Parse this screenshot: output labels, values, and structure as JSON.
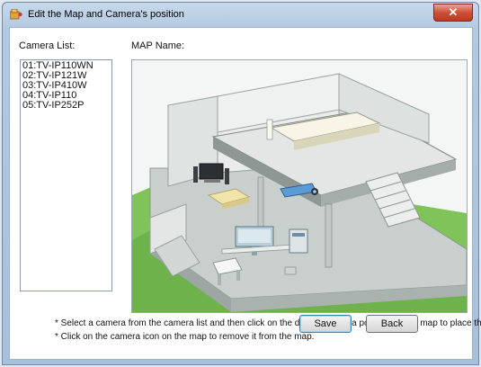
{
  "window": {
    "title": "Edit the Map and Camera's position",
    "close_label": "✕"
  },
  "camera_list": {
    "label": "Camera List:",
    "items": [
      "01:TV-IP110WN",
      "02:TV-IP121W",
      "03:TV-IP410W",
      "04:TV-IP110",
      "05:TV-IP252P"
    ]
  },
  "map": {
    "label": "MAP Name:"
  },
  "notes": {
    "line1": "* Select a camera from the camera list and then click on the desired camera position on the map to place the ca",
    "line2": "* Click on the camera icon on the map to remove it from the map."
  },
  "buttons": {
    "save": "Save",
    "back": "Back"
  },
  "colors": {
    "accent": "#3c7fb1",
    "close_red": "#c13821",
    "grass": "#7fc35a"
  }
}
